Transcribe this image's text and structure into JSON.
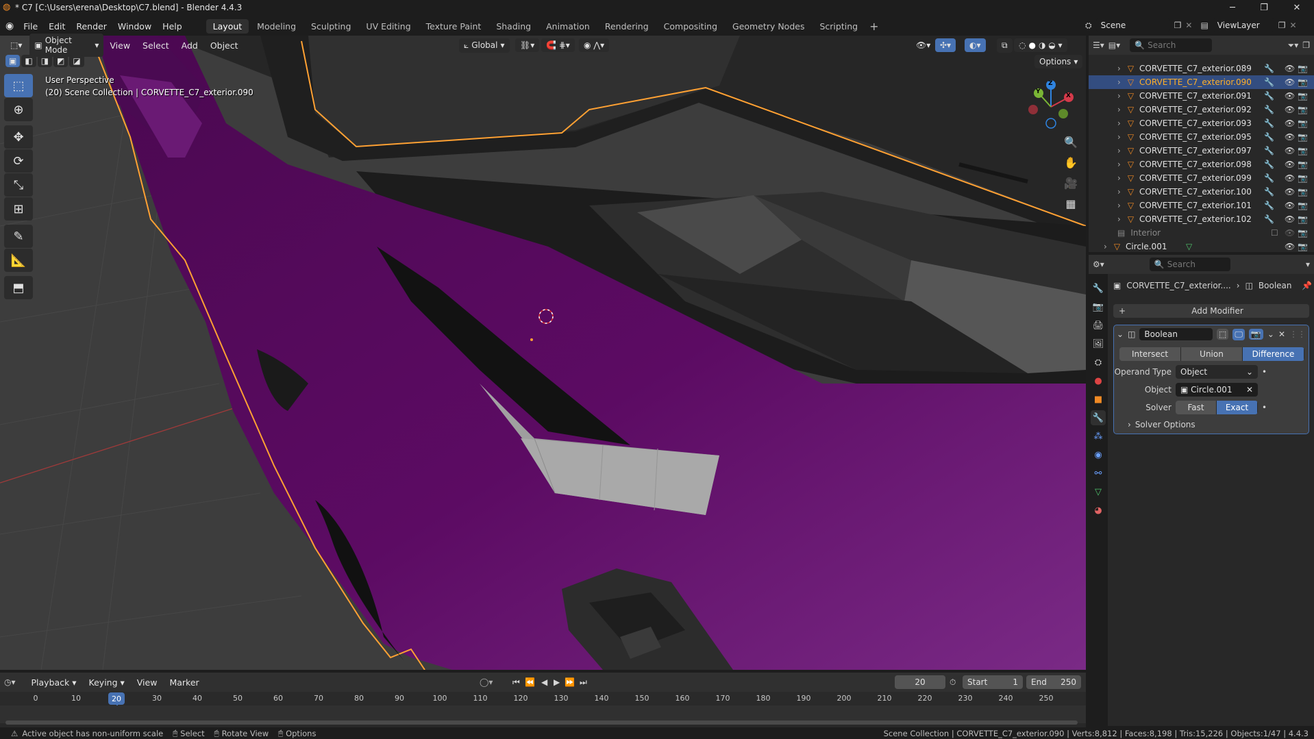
{
  "title": "* C7 [C:\\Users\\erena\\Desktop\\C7.blend] - Blender 4.4.3",
  "menu": [
    "File",
    "Edit",
    "Render",
    "Window",
    "Help"
  ],
  "workspaces": [
    "Layout",
    "Modeling",
    "Sculpting",
    "UV Editing",
    "Texture Paint",
    "Shading",
    "Animation",
    "Rendering",
    "Compositing",
    "Geometry Nodes",
    "Scripting"
  ],
  "active_workspace": "Layout",
  "scene": "Scene",
  "view_layer": "ViewLayer",
  "viewport": {
    "mode": "Object Mode",
    "menus": [
      "View",
      "Select",
      "Add",
      "Object"
    ],
    "orientation": "Global",
    "options": "Options",
    "info_line1": "User Perspective",
    "info_line2": "(20) Scene Collection | CORVETTE_C7_exterior.090",
    "gizmo": {
      "z": "Z",
      "y": "Y",
      "x": "X"
    }
  },
  "outliner": {
    "search_placeholder": "Search",
    "rows": [
      {
        "name": "CORVETTE_C7_exterior.089",
        "selected": false
      },
      {
        "name": "CORVETTE_C7_exterior.090",
        "selected": true
      },
      {
        "name": "CORVETTE_C7_exterior.091",
        "selected": false
      },
      {
        "name": "CORVETTE_C7_exterior.092",
        "selected": false
      },
      {
        "name": "CORVETTE_C7_exterior.093",
        "selected": false
      },
      {
        "name": "CORVETTE_C7_exterior.095",
        "selected": false
      },
      {
        "name": "CORVETTE_C7_exterior.097",
        "selected": false
      },
      {
        "name": "CORVETTE_C7_exterior.098",
        "selected": false
      },
      {
        "name": "CORVETTE_C7_exterior.099",
        "selected": false
      },
      {
        "name": "CORVETTE_C7_exterior.100",
        "selected": false
      },
      {
        "name": "CORVETTE_C7_exterior.101",
        "selected": false
      },
      {
        "name": "CORVETTE_C7_exterior.102",
        "selected": false
      }
    ],
    "interior": "Interior",
    "circle": "Circle.001"
  },
  "properties": {
    "search_placeholder": "Search",
    "breadcrumb_object": "CORVETTE_C7_exterior....",
    "breadcrumb_modifier": "Boolean",
    "add_modifier": "Add Modifier",
    "modifier_name": "Boolean",
    "operations": [
      "Intersect",
      "Union",
      "Difference"
    ],
    "active_operation": "Difference",
    "operand_type_label": "Operand Type",
    "operand_type": "Object",
    "object_label": "Object",
    "object_value": "Circle.001",
    "solver_label": "Solver",
    "solvers": [
      "Fast",
      "Exact"
    ],
    "active_solver": "Exact",
    "solver_options": "Solver Options"
  },
  "timeline": {
    "menus": [
      "Playback",
      "Keying",
      "View",
      "Marker"
    ],
    "current_frame": "20",
    "start_label": "Start",
    "start": "1",
    "end_label": "End",
    "end": "250",
    "ticks": [
      "0",
      "10",
      "20",
      "30",
      "40",
      "50",
      "60",
      "70",
      "80",
      "90",
      "100",
      "110",
      "120",
      "130",
      "140",
      "150",
      "160",
      "170",
      "180",
      "190",
      "200",
      "210",
      "220",
      "230",
      "240",
      "250"
    ]
  },
  "status": {
    "warning": "Active object has non-uniform scale",
    "select": "Select",
    "rotate": "Rotate View",
    "options": "Options",
    "right": "Scene Collection | CORVETTE_C7_exterior.090 | Verts:8,812 | Faces:8,198 | Tris:15,226 | Objects:1/47 | 4.4.3"
  },
  "colors": {
    "accent": "#4772b3",
    "selection_outline": "#ffa133",
    "body_purple": "#5c0b63"
  }
}
